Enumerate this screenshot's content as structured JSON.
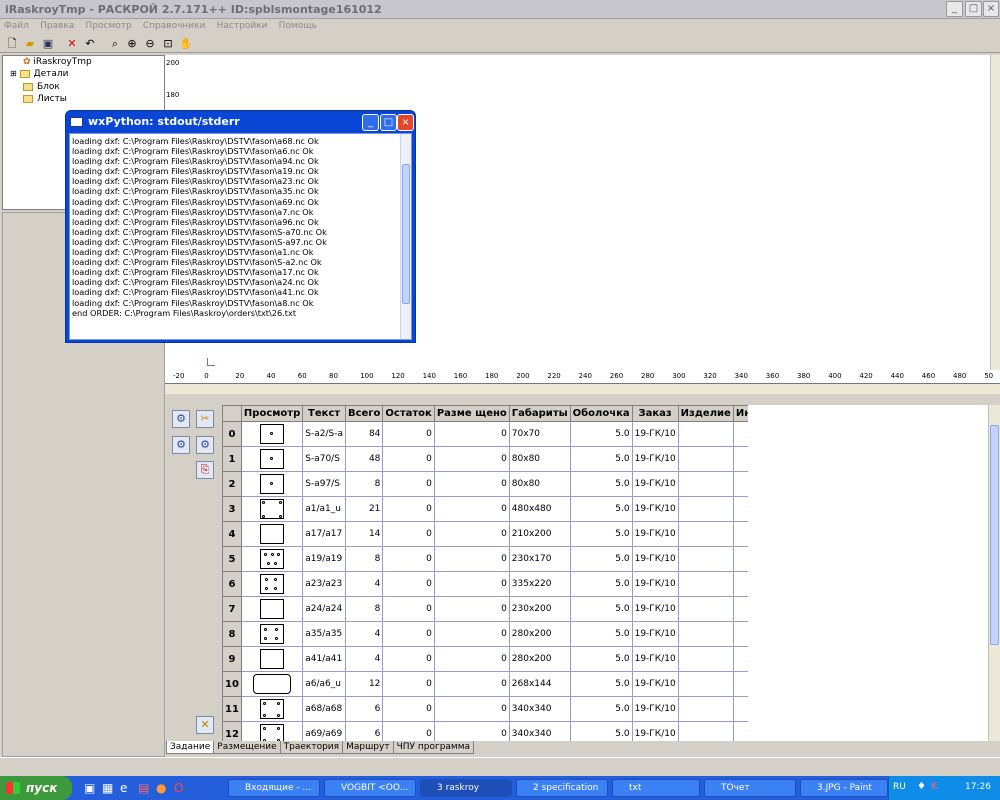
{
  "window": {
    "title": "iRaskroyTmp - РАСКРОЙ 2.7.171++ ID:spblsmontage161012"
  },
  "menu": [
    "Файл",
    "Правка",
    "Просмотр",
    "Справочники",
    "Настройки",
    "Помощь"
  ],
  "tree": {
    "root": "iRaskroyTmp",
    "items": [
      "Детали",
      "Блок",
      "Листы"
    ]
  },
  "ruler": {
    "y_ticks": [
      "200",
      "180"
    ],
    "x_ticks": [
      "-20",
      "0",
      "20",
      "40",
      "60",
      "80",
      "100",
      "120",
      "140",
      "160",
      "180",
      "200",
      "220",
      "240",
      "260",
      "280",
      "300",
      "320",
      "340",
      "360",
      "380",
      "400",
      "420",
      "440",
      "460",
      "480",
      "50"
    ]
  },
  "popup": {
    "title": "wxPython: stdout/stderr",
    "lines": [
      "loading dxf:  C:\\Program Files\\Raskroy\\DSTV\\fason\\a68.nc Ok",
      "loading dxf:  C:\\Program Files\\Raskroy\\DSTV\\fason\\a6.nc Ok",
      "loading dxf:  C:\\Program Files\\Raskroy\\DSTV\\fason\\a94.nc Ok",
      "loading dxf:  C:\\Program Files\\Raskroy\\DSTV\\fason\\a19.nc Ok",
      "loading dxf:  C:\\Program Files\\Raskroy\\DSTV\\fason\\a23.nc Ok",
      "loading dxf:  C:\\Program Files\\Raskroy\\DSTV\\fason\\a35.nc Ok",
      "loading dxf:  C:\\Program Files\\Raskroy\\DSTV\\fason\\a69.nc Ok",
      "loading dxf:  C:\\Program Files\\Raskroy\\DSTV\\fason\\a7.nc Ok",
      "loading dxf:  C:\\Program Files\\Raskroy\\DSTV\\fason\\a96.nc Ok",
      "loading dxf:  C:\\Program Files\\Raskroy\\DSTV\\fason\\S-a70.nc Ok",
      "loading dxf:  C:\\Program Files\\Raskroy\\DSTV\\fason\\S-a97.nc Ok",
      "loading dxf:  C:\\Program Files\\Raskroy\\DSTV\\fason\\a1.nc Ok",
      "loading dxf:  C:\\Program Files\\Raskroy\\DSTV\\fason\\S-a2.nc Ok",
      "loading dxf:  C:\\Program Files\\Raskroy\\DSTV\\fason\\a17.nc Ok",
      "loading dxf:  C:\\Program Files\\Raskroy\\DSTV\\fason\\a24.nc Ok",
      "loading dxf:  C:\\Program Files\\Raskroy\\DSTV\\fason\\a41.nc Ok",
      "loading dxf:  C:\\Program Files\\Raskroy\\DSTV\\fason\\a8.nc Ok",
      "end ORDER: C:\\Program Files\\Raskroy\\orders\\txt\\26.txt"
    ]
  },
  "grid": {
    "headers": [
      "Просмотр",
      "Текст",
      "Всего",
      "Остаток",
      "Разме щено",
      "Габариты",
      "Оболочка",
      "Заказ",
      "Изделие",
      "Инфо о детали"
    ],
    "rows": [
      {
        "n": "0",
        "text": "S-a2/S-a",
        "total": "84",
        "rest": "0",
        "placed": "0",
        "size": "70x70",
        "shell": "5.0",
        "order": "19-ГК/10"
      },
      {
        "n": "1",
        "text": "S-a70/S",
        "total": "48",
        "rest": "0",
        "placed": "0",
        "size": "80x80",
        "shell": "5.0",
        "order": "19-ГК/10"
      },
      {
        "n": "2",
        "text": "S-a97/S",
        "total": "8",
        "rest": "0",
        "placed": "0",
        "size": "80x80",
        "shell": "5.0",
        "order": "19-ГК/10"
      },
      {
        "n": "3",
        "text": "a1/a1_u",
        "total": "21",
        "rest": "0",
        "placed": "0",
        "size": "480x480",
        "shell": "5.0",
        "order": "19-ГК/10"
      },
      {
        "n": "4",
        "text": "a17/a17",
        "total": "14",
        "rest": "0",
        "placed": "0",
        "size": "210x200",
        "shell": "5.0",
        "order": "19-ГК/10"
      },
      {
        "n": "5",
        "text": "a19/a19",
        "total": "8",
        "rest": "0",
        "placed": "0",
        "size": "230x170",
        "shell": "5.0",
        "order": "19-ГК/10"
      },
      {
        "n": "6",
        "text": "a23/a23",
        "total": "4",
        "rest": "0",
        "placed": "0",
        "size": "335x220",
        "shell": "5.0",
        "order": "19-ГК/10"
      },
      {
        "n": "7",
        "text": "a24/a24",
        "total": "8",
        "rest": "0",
        "placed": "0",
        "size": "230x200",
        "shell": "5.0",
        "order": "19-ГК/10"
      },
      {
        "n": "8",
        "text": "a35/a35",
        "total": "4",
        "rest": "0",
        "placed": "0",
        "size": "280x200",
        "shell": "5.0",
        "order": "19-ГК/10"
      },
      {
        "n": "9",
        "text": "a41/a41",
        "total": "4",
        "rest": "0",
        "placed": "0",
        "size": "280x200",
        "shell": "5.0",
        "order": "19-ГК/10"
      },
      {
        "n": "10",
        "text": "a6/a6_u",
        "total": "12",
        "rest": "0",
        "placed": "0",
        "size": "268x144",
        "shell": "5.0",
        "order": "19-ГК/10"
      },
      {
        "n": "11",
        "text": "a68/a68",
        "total": "6",
        "rest": "0",
        "placed": "0",
        "size": "340x340",
        "shell": "5.0",
        "order": "19-ГК/10"
      },
      {
        "n": "12",
        "text": "a69/a69",
        "total": "6",
        "rest": "0",
        "placed": "0",
        "size": "340x340",
        "shell": "5.0",
        "order": "19-ГК/10"
      }
    ]
  },
  "tabs": [
    "Задание",
    "Размещение",
    "Траектория",
    "Маршрут",
    "ЧПУ программа"
  ],
  "taskbar": {
    "start": "пуск",
    "tasks": [
      "Входящие - ...",
      "VOGBIT <OO...",
      "3 raskroy",
      "2 specification",
      "txt",
      "ТОчет",
      "3.JPG - Paint"
    ],
    "lang": "RU",
    "clock": "17:26"
  },
  "colors": {
    "accent": "#0a46d6",
    "taskbar": "#245edb",
    "start": "#3c9a3c",
    "grid_line": "#9a9ad0"
  }
}
